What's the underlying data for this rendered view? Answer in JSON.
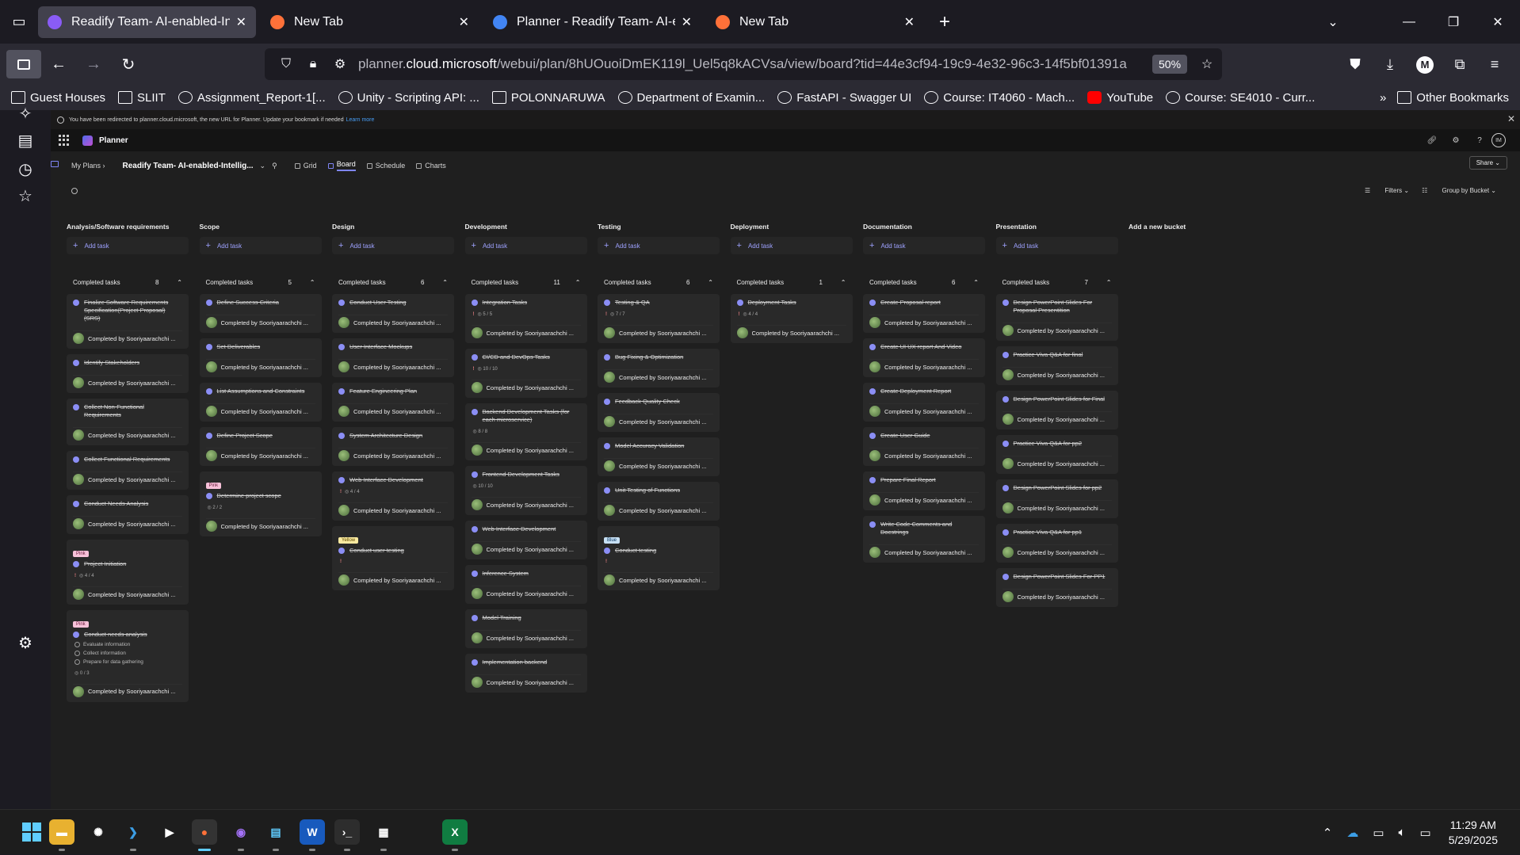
{
  "browser": {
    "tabs": [
      {
        "title": "Readify Team- AI-enabled-Intelli",
        "active": true,
        "favicon_color": "#8a5cf6"
      },
      {
        "title": "New Tab",
        "active": false,
        "favicon_color": "#ff7139"
      },
      {
        "title": "Planner - Readify Team- AI-enab",
        "active": false,
        "favicon_color": "#4285f4"
      },
      {
        "title": "New Tab",
        "active": false,
        "favicon_color": "#ff7139"
      }
    ],
    "url_prefix": "planner.",
    "url_domain": "cloud.microsoft",
    "url_path": "/webui/plan/8hUOuoiDmEK119l_Uel5q8kACVsa/view/board?tid=44e3cf94-19c9-4e32-96c3-14f5bf01391a",
    "zoom": "50%",
    "account_initial": "M",
    "bookmarks": [
      {
        "label": "Guest Houses",
        "icon": "folder-icon"
      },
      {
        "label": "SLIIT",
        "icon": "folder-icon"
      },
      {
        "label": "Assignment_Report-1[...",
        "icon": "globe-icon"
      },
      {
        "label": "Unity - Scripting API: ...",
        "icon": "unity-icon"
      },
      {
        "label": "POLONNARUWA",
        "icon": "folder-icon"
      },
      {
        "label": "Department of Examin...",
        "icon": "emblem-icon"
      },
      {
        "label": "FastAPI - Swagger UI",
        "icon": "fastapi-icon"
      },
      {
        "label": "Course: IT4060 - Mach...",
        "icon": "course-icon"
      },
      {
        "label": "YouTube",
        "icon": "youtube-icon"
      },
      {
        "label": "Course: SE4010 - Curr...",
        "icon": "course-icon"
      }
    ],
    "other_bookmarks": "Other Bookmarks"
  },
  "notice": {
    "text": "You have been redirected to planner.cloud.microsoft, the new URL for Planner. Update your bookmark if needed",
    "link": "Learn more"
  },
  "app": {
    "name": "Planner",
    "user_initials": "IM"
  },
  "plan": {
    "breadcrumb": "My Plans",
    "name": "Readify Team- AI-enabled-Intellig...",
    "views": [
      {
        "label": "Grid",
        "active": false
      },
      {
        "label": "Board",
        "active": true
      },
      {
        "label": "Schedule",
        "active": false
      },
      {
        "label": "Charts",
        "active": false
      }
    ],
    "share": "Share",
    "filters": "Filters",
    "group_by": "Group by Bucket"
  },
  "board": {
    "add_task_label": "Add task",
    "completed_label": "Completed tasks",
    "completed_by": "Completed by Sooriyaarachchi ...",
    "add_bucket": "Add a new bucket",
    "buckets": [
      {
        "name": "Analysis/Software requirements",
        "completed_count": "8",
        "cards": [
          {
            "title": "Finalize Software Requirements Specification(Project Proposal) (SRS)"
          },
          {
            "title": "Identify Stakeholders"
          },
          {
            "title": "Collect Non-Functional Requirements"
          },
          {
            "title": "Collect Functional Requirements"
          },
          {
            "title": "Conduct Needs Analysis"
          },
          {
            "label": "Pink",
            "label_color": "pink",
            "title": "Project Initiation",
            "meta": "4 / 4",
            "urgent": true
          },
          {
            "label": "Pink",
            "label_color": "pink",
            "title": "Conduct needs analysis",
            "checklist": [
              "Evaluate information",
              "Collect information",
              "Prepare for data gathering"
            ],
            "meta": "0 / 3"
          }
        ]
      },
      {
        "name": "Scope",
        "completed_count": "5",
        "cards": [
          {
            "title": "Define Success Criteria"
          },
          {
            "title": "Set Deliverables"
          },
          {
            "title": "List Assumptions and Constraints"
          },
          {
            "title": "Define Project Scope"
          },
          {
            "label": "Pink",
            "label_color": "pink",
            "title": "Determine project scope",
            "meta": "2 / 2"
          }
        ]
      },
      {
        "name": "Design",
        "completed_count": "6",
        "cards": [
          {
            "title": "Conduct User Testing"
          },
          {
            "title": "User Interface Mockups"
          },
          {
            "title": "Feature Engineering Plan"
          },
          {
            "title": "System Architecture Design"
          },
          {
            "title": "Web Interface Development",
            "meta": "4 / 4",
            "urgent": true
          },
          {
            "label": "Yellow",
            "label_color": "yellow",
            "title": "Conduct user testing",
            "urgent_only": true
          }
        ]
      },
      {
        "name": "Development",
        "completed_count": "11",
        "cards": [
          {
            "title": "Integration Tasks",
            "meta": "5 / 5",
            "urgent": true
          },
          {
            "title": "CI/CD and DevOps Tasks",
            "meta": "10 / 10",
            "urgent": true
          },
          {
            "title": "Backend Development Tasks (for each microservice)",
            "meta": "8 / 8"
          },
          {
            "title": "Frontend Development Tasks",
            "meta": "10 / 10"
          },
          {
            "title": "Web Interface Development"
          },
          {
            "title": "Inference System"
          },
          {
            "title": "Model Training"
          },
          {
            "title": "Implementation backend"
          }
        ]
      },
      {
        "name": "Testing",
        "completed_count": "6",
        "cards": [
          {
            "title": "Testing & QA",
            "meta": "7 / 7",
            "urgent": true
          },
          {
            "title": "Bug Fixing & Optimization"
          },
          {
            "title": "Feedback Quality Check"
          },
          {
            "title": "Model Accuracy Validation"
          },
          {
            "title": "Unit Testing of Functions"
          },
          {
            "label": "Blue",
            "label_color": "blue",
            "title": "Conduct testing",
            "urgent_only": true
          }
        ]
      },
      {
        "name": "Deployment",
        "completed_count": "1",
        "cards": [
          {
            "title": "Deployment Tasks",
            "meta": "4 / 4",
            "urgent": true
          }
        ]
      },
      {
        "name": "Documentation",
        "completed_count": "6",
        "cards": [
          {
            "title": "Create Proposal report"
          },
          {
            "title": "Create UI UX report And Video"
          },
          {
            "title": "Create Deployment Report"
          },
          {
            "title": "Create User Guide"
          },
          {
            "title": "Prepare Final Report"
          },
          {
            "title": "Write Code Comments and Docstrings"
          }
        ]
      },
      {
        "name": "Presentation",
        "completed_count": "7",
        "cards": [
          {
            "title": "Design PowerPoint Slides For Proposal Presentition"
          },
          {
            "title": "Practice Viva Q&A for final"
          },
          {
            "title": "Design PowerPoint Slides for Final"
          },
          {
            "title": "Practice Viva Q&A for pp2"
          },
          {
            "title": "Design PowerPoint Slides for pp2"
          },
          {
            "title": "Practice Viva Q&A for pp1"
          },
          {
            "title": "Design PowerPoint Slides For PP1"
          }
        ]
      }
    ]
  },
  "taskbar": {
    "time": "11:29 AM",
    "date": "5/29/2025"
  }
}
